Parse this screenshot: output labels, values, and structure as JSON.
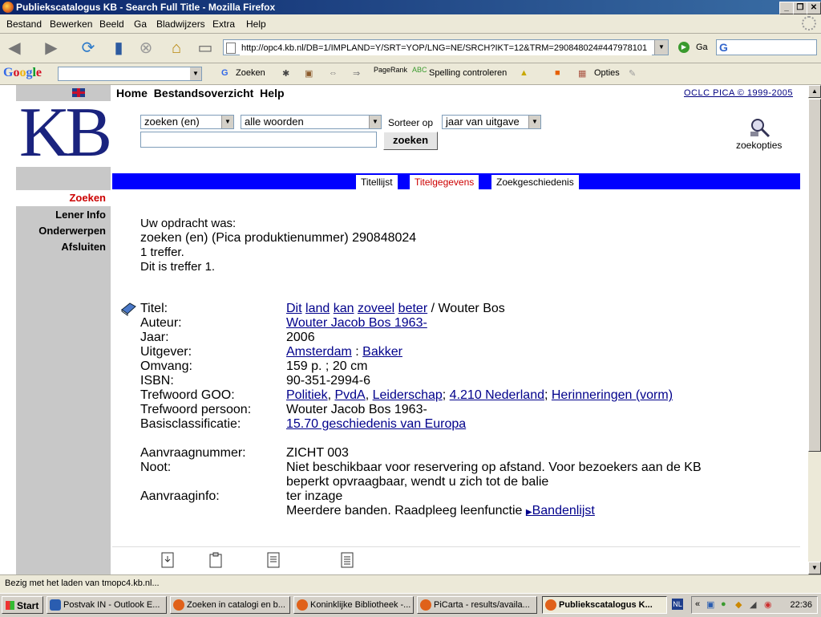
{
  "window": {
    "title": "Publiekscatalogus KB - Search Full Title - Mozilla Firefox",
    "buttons": [
      "_",
      "❐",
      "✕"
    ]
  },
  "menu": [
    "Bestand",
    "Bewerken",
    "Beeld",
    "Ga",
    "Bladwijzers",
    "Extra",
    "Help"
  ],
  "navbar": {
    "url": "http://opc4.kb.nl/DB=1/IMPLAND=Y/SRT=YOP/LNG=NE/SRCH?IKT=12&TRM=290848024#447978101",
    "go_label": "Ga"
  },
  "google_toolbar": {
    "logo": "Google",
    "zoeken": "Zoeken",
    "pagerank": "PageRank",
    "spelling": "Spelling controleren",
    "opties": "Opties"
  },
  "site": {
    "logo_text": "KB",
    "topnav": [
      "Home",
      "Bestandsoverzicht",
      "Help"
    ],
    "copyright": "OCLC PICA © 1999-2005",
    "sidebar": [
      "Zoeken",
      "Lener Info",
      "Onderwerpen",
      "Afsluiten"
    ],
    "search": {
      "field_select": "zoeken (en)",
      "mode_select": "alle woorden",
      "sort_label": "Sorteer op",
      "sort_select": "jaar van uitgave",
      "query_value": "",
      "button": "zoeken",
      "options_label": "zoekopties"
    },
    "tabs": [
      "Titellijst",
      "Titelgegevens",
      "Zoekgeschiedenis"
    ],
    "intro": {
      "line1": "Uw opdracht was:",
      "line2": "zoeken (en) (Pica produktienummer) 290848024",
      "line3": "1 treffer.",
      "line4": "Dit is treffer 1."
    },
    "record": {
      "titel_label": "Titel:",
      "titel_words": [
        "Dit",
        "land",
        "kan",
        "zoveel",
        "beter"
      ],
      "titel_rest": " / Wouter Bos",
      "auteur_label": "Auteur:",
      "auteur": "Wouter Jacob Bos 1963-",
      "jaar_label": "Jaar:",
      "jaar": "2006",
      "uitgever_label": "Uitgever:",
      "uitgever_plaats": "Amsterdam",
      "uitgever_sep": " : ",
      "uitgever_naam": "Bakker",
      "omvang_label": "Omvang:",
      "omvang": "159 p. ; 20 cm",
      "isbn_label": "ISBN:",
      "isbn": "90-351-2994-6",
      "goo_label": "Trefwoord GOO:",
      "goo": [
        "Politiek",
        "PvdA",
        "Leiderschap",
        "4.210 Nederland",
        "Herinneringen (vorm)"
      ],
      "persoon_label": "Trefwoord persoon:",
      "persoon": "Wouter Jacob Bos 1963-",
      "basis_label": "Basisclassificatie:",
      "basis": "15.70 geschiedenis van Europa",
      "aanvraagnummer_label": "Aanvraagnummer:",
      "aanvraagnummer": "ZICHT 003",
      "noot_label": "Noot:",
      "noot_line1": "Niet beschikbaar voor reservering op afstand. Voor bezoekers aan de KB",
      "noot_line2": "beperkt opvraagbaar, wendt u zich tot de balie",
      "aanvraaginfo_label": "Aanvraaginfo:",
      "aanvraaginfo_line1": "ter inzage",
      "aanvraaginfo_line2": "Meerdere banden. Raadpleeg leenfunctie",
      "bandenlijst": "Bandenlijst"
    }
  },
  "status": "Bezig met het laden van tmopc4.kb.nl...",
  "taskbar": {
    "start": "Start",
    "tasks": [
      "Postvak IN - Outlook E...",
      "Zoeken in catalogi en b...",
      "Koninklijke Bibliotheek -...",
      "PiCarta - results/availa...",
      "Publiekscatalogus K..."
    ],
    "lang": "NL",
    "time": "22:36"
  }
}
